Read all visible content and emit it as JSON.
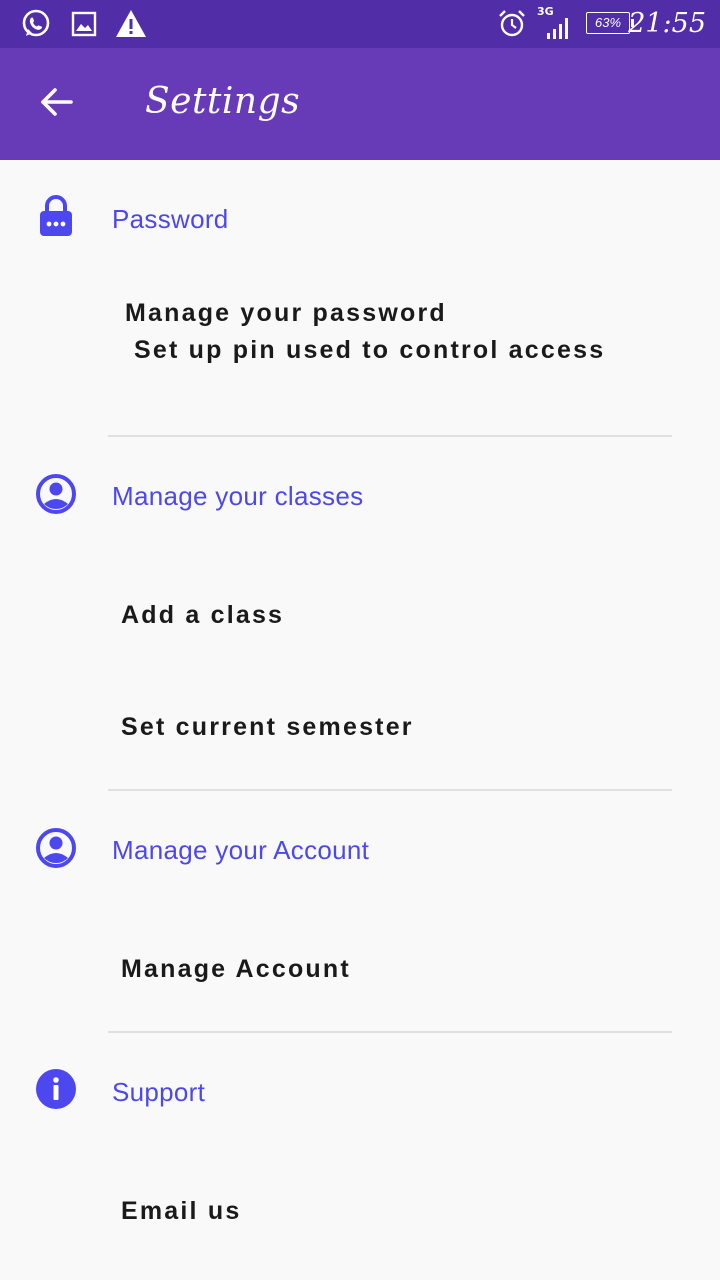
{
  "status_bar": {
    "time": "21:55",
    "battery": "63%",
    "network": "3G",
    "icons": [
      "whatsapp-icon",
      "image-icon",
      "warning-icon",
      "alarm-icon",
      "signal-icon",
      "battery-icon"
    ]
  },
  "app_bar": {
    "title": "Settings",
    "back_icon": "arrow-back-icon"
  },
  "sections": [
    {
      "title": "Password",
      "icon": "lock-icon",
      "items": [
        "Manage your password",
        "Set up pin used to control access"
      ]
    },
    {
      "title": "Manage your classes",
      "icon": "account-circle-icon",
      "items": [
        "Add a class",
        "Set current semester"
      ]
    },
    {
      "title": "Manage your Account",
      "icon": "account-circle-icon",
      "items": [
        "Manage Account"
      ]
    },
    {
      "title": "Support",
      "icon": "info-icon",
      "items": [
        "Email us"
      ]
    }
  ],
  "colors": {
    "status_bar": "#512da8",
    "app_bar": "#673ab7",
    "accent": "#4d47f0",
    "background": "#f9f9f9"
  }
}
